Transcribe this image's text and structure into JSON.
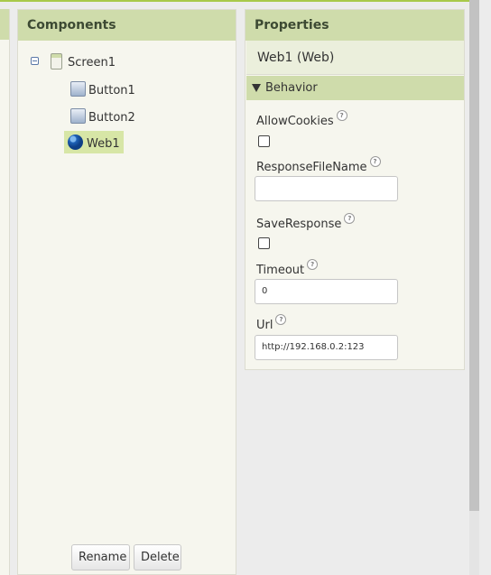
{
  "components": {
    "title": "Components",
    "tree": {
      "root": "Screen1",
      "children": [
        "Button1",
        "Button2",
        "Web1"
      ],
      "selected": "Web1"
    },
    "rename_label": "Rename",
    "delete_label": "Delete"
  },
  "properties": {
    "title": "Properties",
    "component_title": "Web1 (Web)",
    "section": "Behavior",
    "help_glyph": "?",
    "fields": {
      "allow_cookies": {
        "label": "AllowCookies",
        "checked": false
      },
      "response_file_name": {
        "label": "ResponseFileName",
        "value": ""
      },
      "save_response": {
        "label": "SaveResponse",
        "checked": false
      },
      "timeout": {
        "label": "Timeout",
        "value": "0"
      },
      "url": {
        "label": "Url",
        "value": "http://192.168.0.2:123"
      }
    }
  },
  "colors": {
    "header_bg": "#cfdcab",
    "panel_bg": "#f6f6ee",
    "selected_bg": "#d7e6a6",
    "accent_line": "#a8c94a"
  },
  "icons": {
    "tree_toggle": "collapse-icon",
    "screen": "screen-icon",
    "button": "button-icon",
    "web": "globe-icon",
    "section": "triangle-down-icon",
    "help": "help-icon"
  }
}
